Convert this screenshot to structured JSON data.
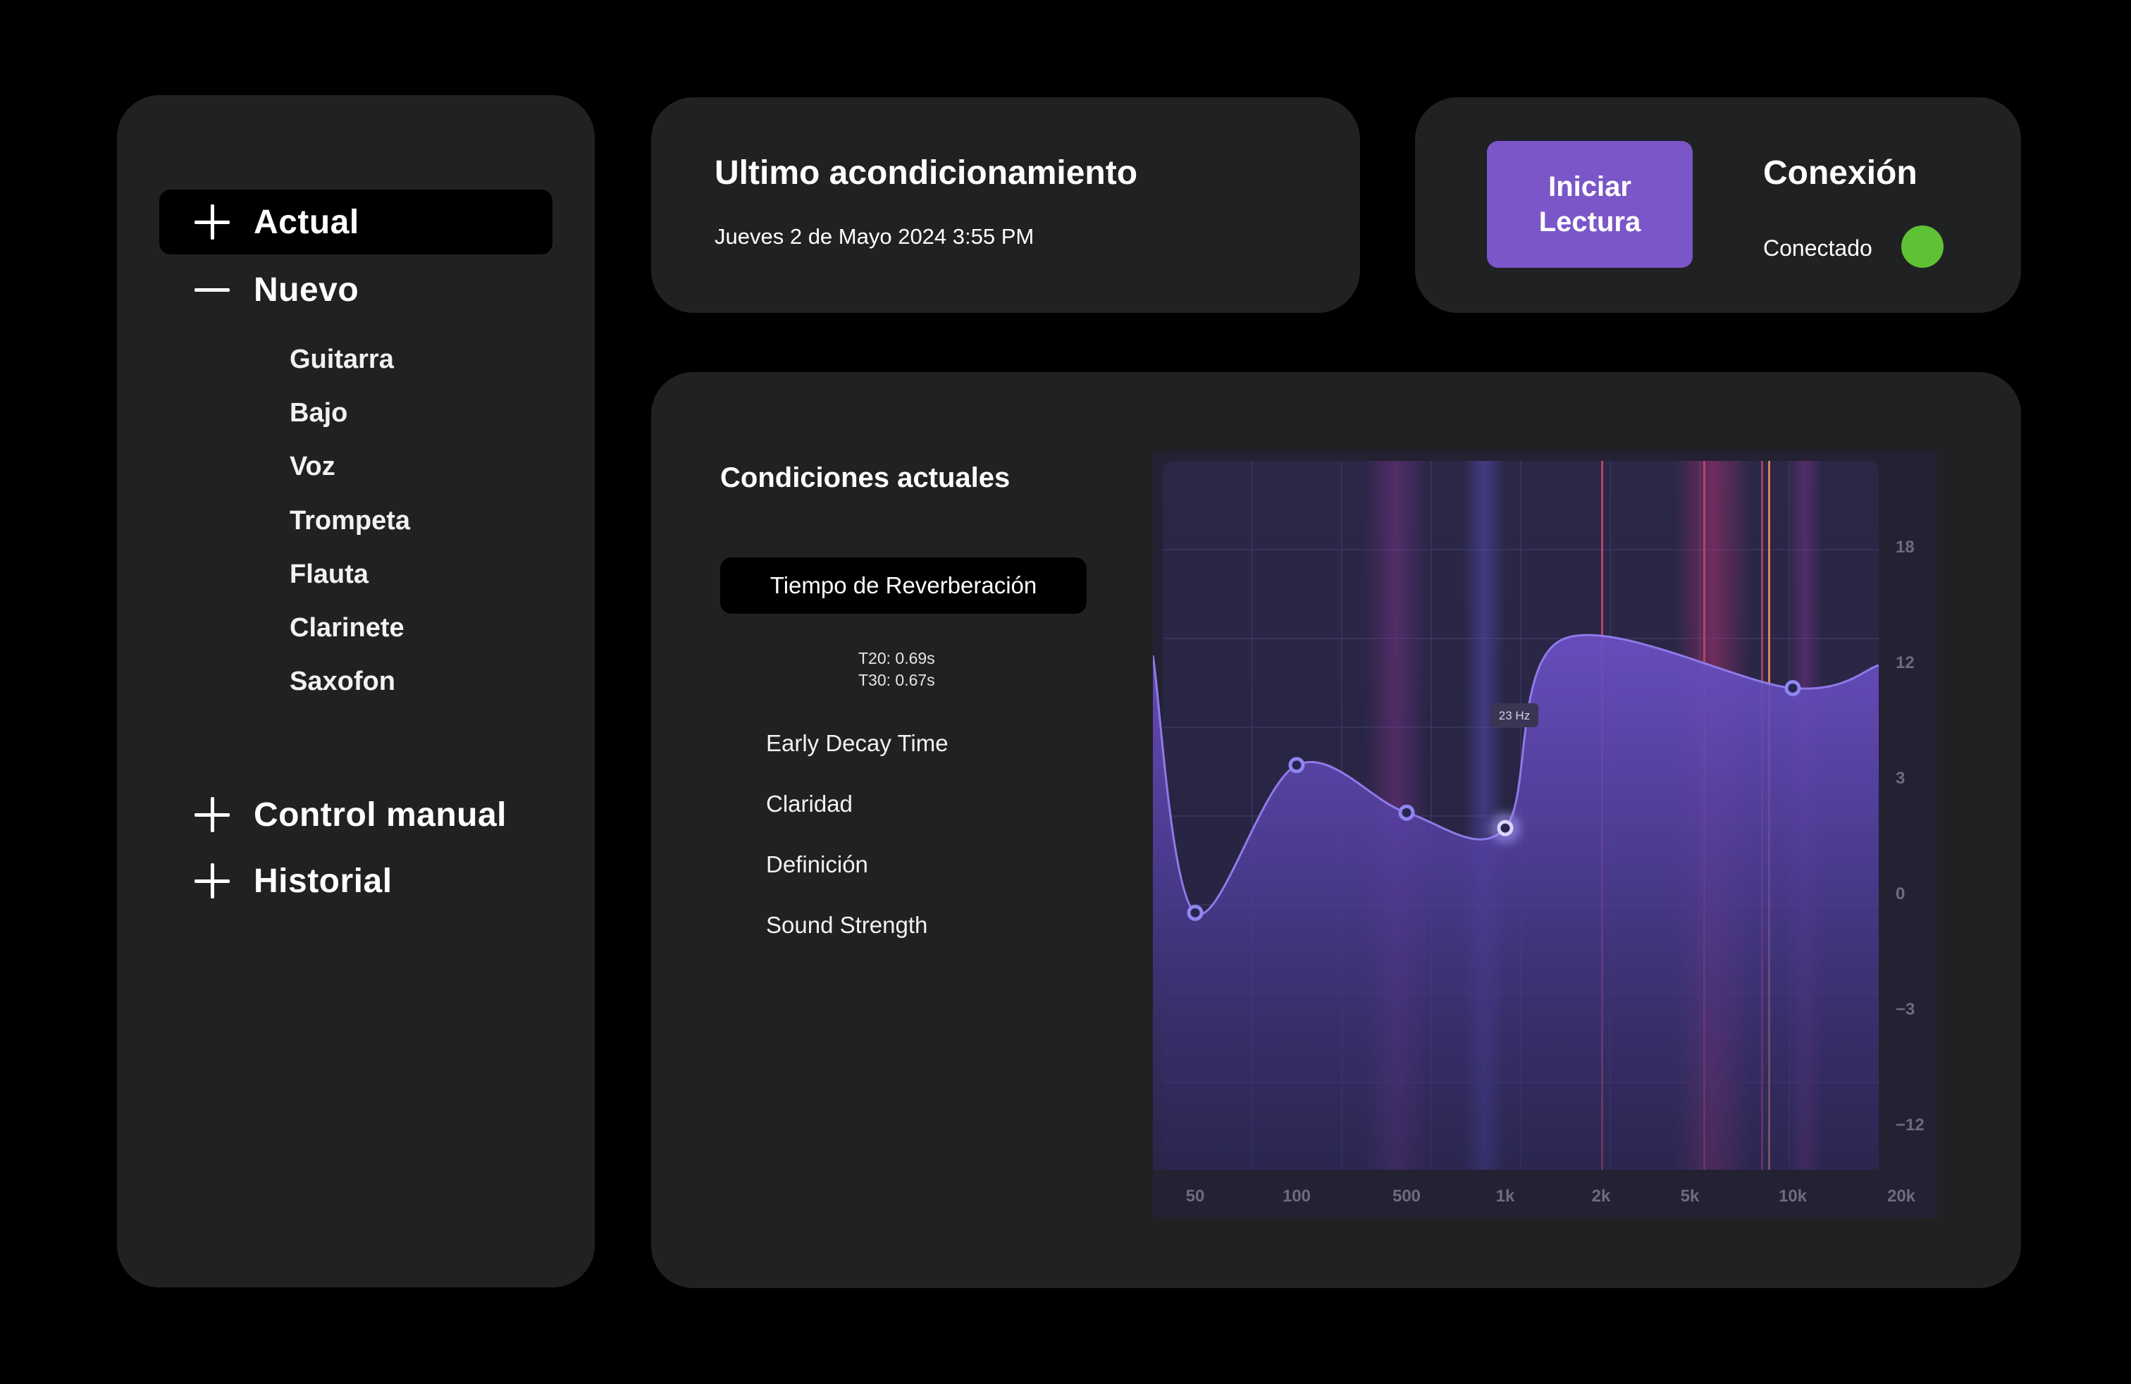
{
  "sidebar": {
    "items": [
      {
        "label": "Actual",
        "sign": "plus",
        "active": true
      },
      {
        "label": "Nuevo",
        "sign": "minus",
        "active": false
      },
      {
        "label": "Control manual",
        "sign": "plus",
        "active": false
      },
      {
        "label": "Historial",
        "sign": "plus",
        "active": false
      }
    ],
    "sub_items": [
      "Guitarra",
      "Bajo",
      "Voz",
      "Trompeta",
      "Flauta",
      "Clarinete",
      "Saxofon"
    ]
  },
  "last_conditioning": {
    "title": "Ultimo acondicionamiento",
    "date": "Jueves 2 de Mayo 2024 3:55 PM"
  },
  "connection": {
    "button_label": "Iniciar\nLectura",
    "title": "Conexión",
    "status": "Conectado",
    "status_color": "#5fc234",
    "button_color": "#7a56c9"
  },
  "conditions": {
    "title": "Condiciones actuales",
    "active_metric": "Tiempo de Reverberación",
    "t20": "T20:  0.69s",
    "t30": "T30:  0.67s",
    "metrics": [
      "Early Decay Time",
      "Claridad",
      "Definición",
      "Sound Strength"
    ]
  },
  "chart_data": {
    "type": "line",
    "x_ticks": [
      "50",
      "100",
      "500",
      "1k",
      "2k",
      "5k",
      "10k",
      "20k"
    ],
    "y_ticks": [
      "18",
      "12",
      "3",
      "0",
      "−3",
      "−12"
    ],
    "tooltip": "23 Hz",
    "points": [
      {
        "x": "50",
        "y": -0.5
      },
      {
        "x": "100",
        "y": 4
      },
      {
        "x": "500",
        "y": 2.1
      },
      {
        "x": "1k",
        "y": 1.7
      },
      {
        "x": "10k",
        "y": 10
      }
    ],
    "colors": {
      "curve": "#8f7ae8",
      "fill": "#5a44b0",
      "marker": "#8f86f0"
    }
  }
}
